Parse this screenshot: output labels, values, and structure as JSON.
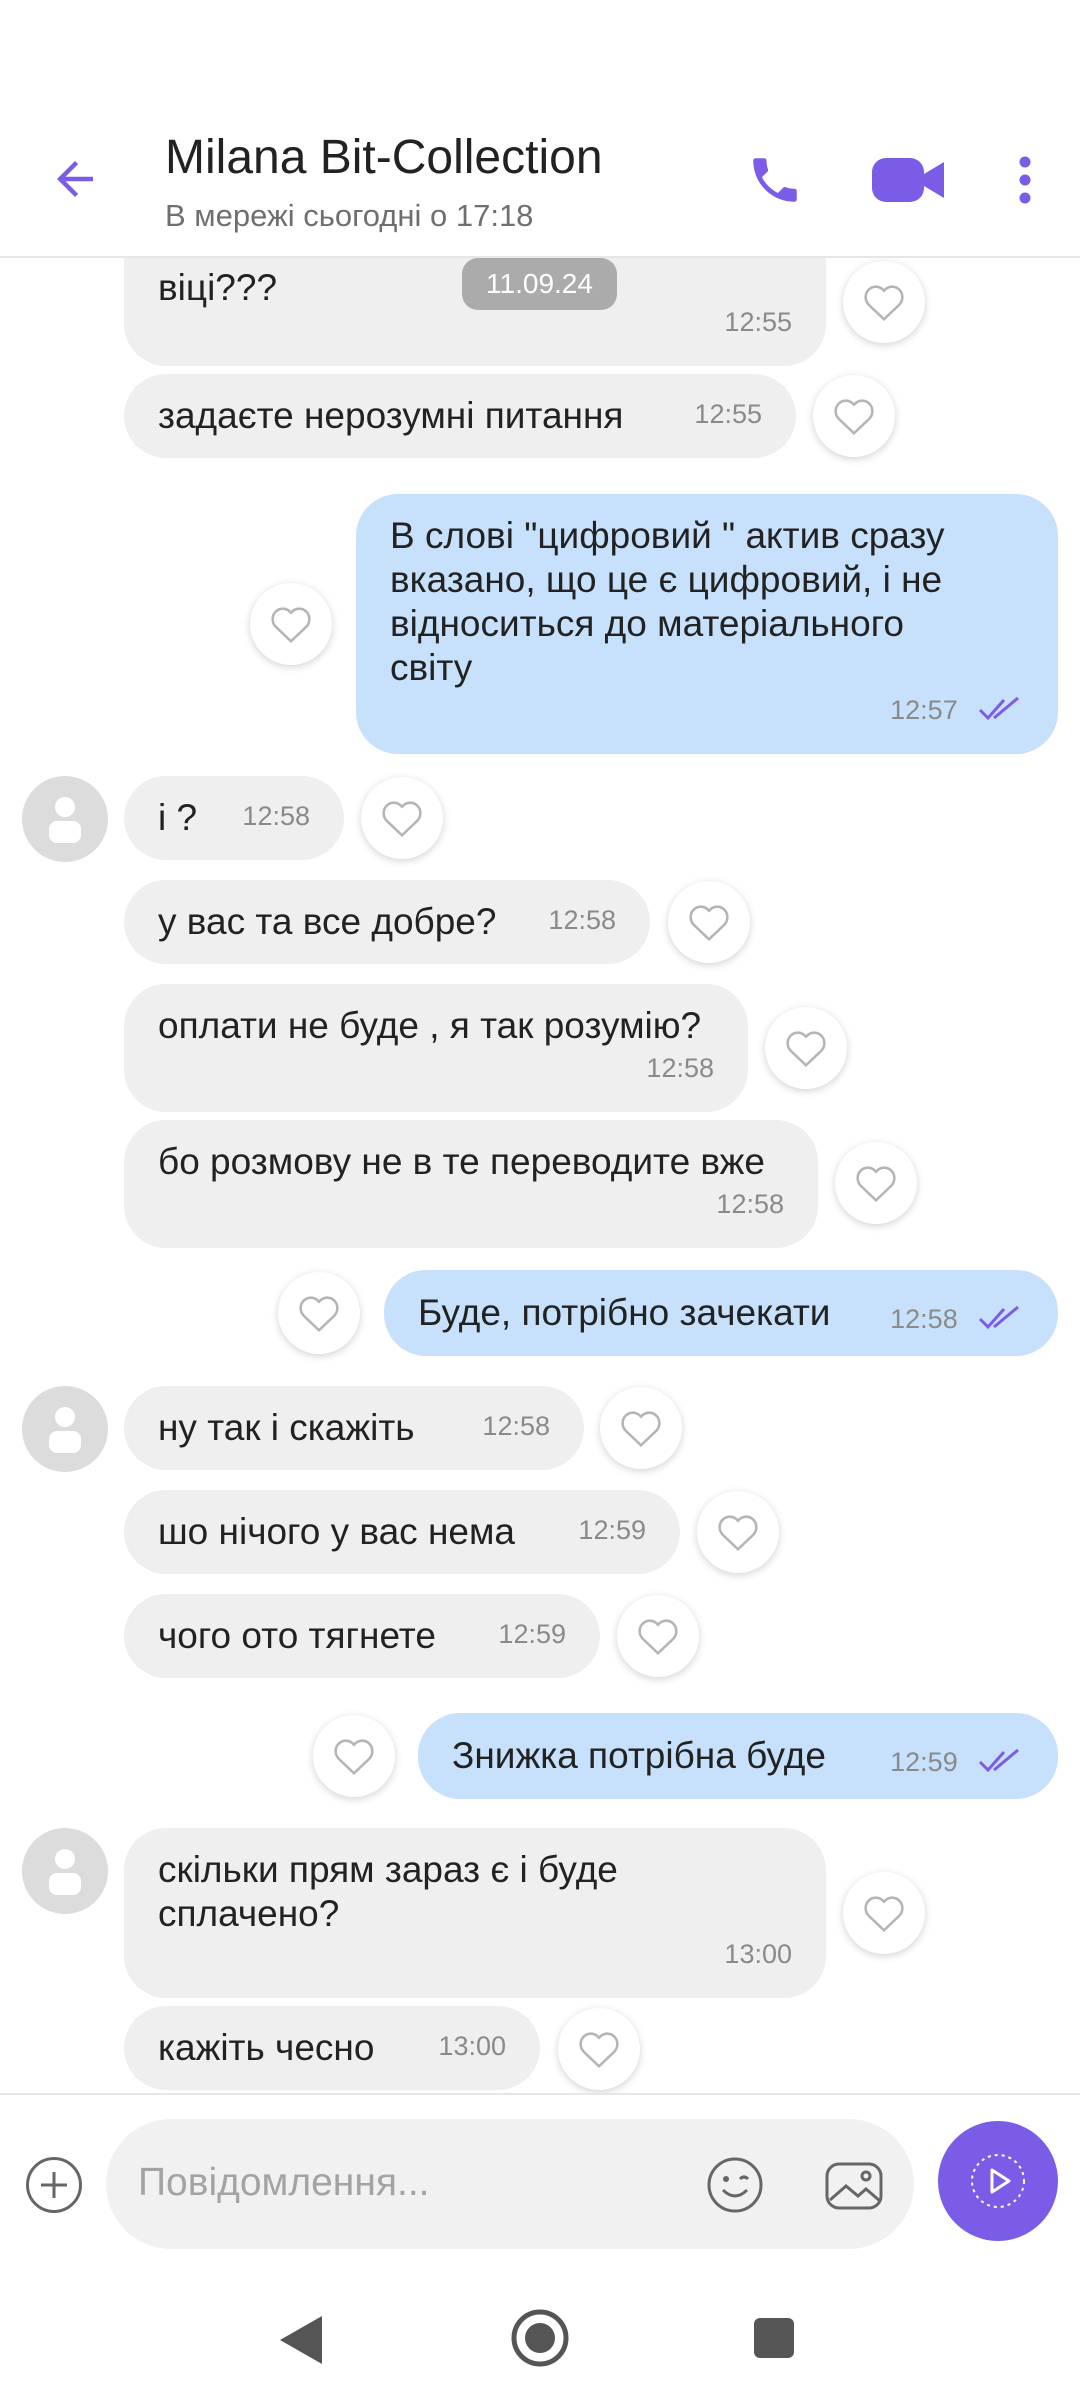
{
  "header": {
    "contact_name": "Milana Bit-Collection",
    "status": "В мережі сьогодні о 17:18",
    "icons": [
      "back-arrow-icon",
      "phone-icon",
      "video-call-icon",
      "more-vert-icon"
    ],
    "accent": "#7b5ce6"
  },
  "date_chip": "11.09.24",
  "messages": [
    {
      "dir": "in",
      "text": "віці???",
      "time": "12:55"
    },
    {
      "dir": "in",
      "text": "задаєте нерозумні питання",
      "time": "12:55"
    },
    {
      "dir": "out",
      "lines": [
        "В слові \"цифровий \" актив сразу",
        "вказано, що це є цифровий, і не",
        "відноситься до матеріального",
        "світу"
      ],
      "time": "12:57"
    },
    {
      "dir": "in",
      "text": "і ?",
      "time": "12:58"
    },
    {
      "dir": "in",
      "text": "у вас та все добре?",
      "time": "12:58"
    },
    {
      "dir": "in",
      "text": "оплати не буде , я так розумію?",
      "time": "12:58"
    },
    {
      "dir": "in",
      "text": "бо розмову не в те переводите вже",
      "time": "12:58"
    },
    {
      "dir": "out",
      "text": "Буде, потрібно зачекати",
      "time": "12:58"
    },
    {
      "dir": "in",
      "text": "ну так і скажіть",
      "time": "12:58"
    },
    {
      "dir": "in",
      "text": "шо нічого у вас нема",
      "time": "12:59"
    },
    {
      "dir": "in",
      "text": "чого ото тягнете",
      "time": "12:59"
    },
    {
      "dir": "out",
      "text": "Знижка потрібна буде",
      "time": "12:59"
    },
    {
      "dir": "in",
      "lines": [
        "скільки прям зараз є і буде",
        "сплачено?"
      ],
      "time": "13:00"
    },
    {
      "dir": "in",
      "text": "кажіть чесно",
      "time": "13:00"
    }
  ],
  "composer": {
    "placeholder": "Повідомлення...",
    "icons": [
      "add-icon",
      "emoji-icon",
      "gallery-icon",
      "send-icon"
    ]
  },
  "navbar": {
    "icons": [
      "nav-back-icon",
      "nav-home-icon",
      "nav-recents-icon"
    ]
  },
  "colors": {
    "incoming_bubble": "#efefef",
    "outgoing_bubble": "#c7e0fb",
    "read_ticks": "#7b5ce6"
  }
}
